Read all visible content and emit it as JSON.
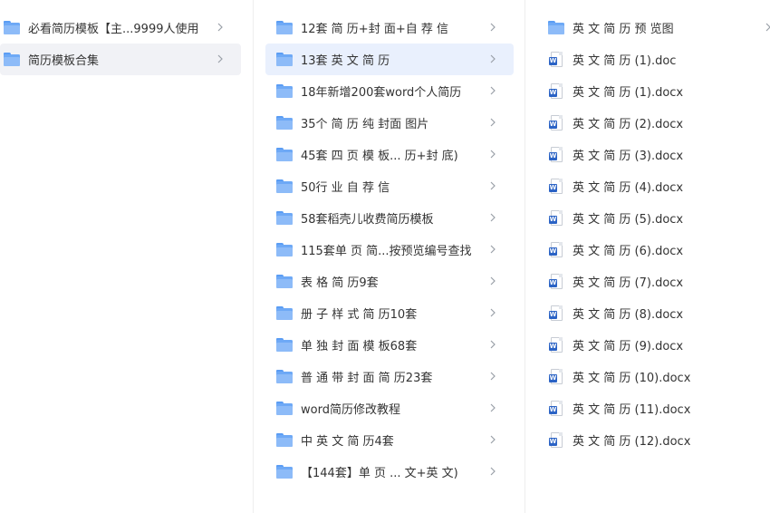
{
  "colors": {
    "folder": "#6ea9f6",
    "selected_bg": "#f1f2f6",
    "active_bg": "#e9f0fd",
    "word_badge": "#2b63c5",
    "text": "#333333",
    "chevron": "#9aa0a8"
  },
  "column1": {
    "items": [
      {
        "label": "必看简历模板【主...9999人使用",
        "icon": "folder-icon"
      },
      {
        "label": "简历模板合集",
        "icon": "folder-icon"
      }
    ]
  },
  "column2": {
    "items": [
      {
        "label": "12套 简 历+封 面+自 荐 信",
        "icon": "folder-icon"
      },
      {
        "label": "13套 英 文 简 历",
        "icon": "folder-icon"
      },
      {
        "label": "18年新增200套word个人简历",
        "icon": "folder-icon"
      },
      {
        "label": "35个 简 历 纯 封面 图片",
        "icon": "folder-icon"
      },
      {
        "label": "45套 四 页 模 板...  历+封 底)",
        "icon": "folder-icon"
      },
      {
        "label": "50行 业 自 荐 信",
        "icon": "folder-icon"
      },
      {
        "label": "58套稻壳儿收费简历模板",
        "icon": "folder-icon"
      },
      {
        "label": "115套单 页 简...按预览编号查找",
        "icon": "folder-icon"
      },
      {
        "label": "表 格 简 历9套",
        "icon": "folder-icon"
      },
      {
        "label": "册 子 样 式 简 历10套",
        "icon": "folder-icon"
      },
      {
        "label": "单 独 封 面 模  板68套",
        "icon": "folder-icon"
      },
      {
        "label": "普 通 带 封 面 简 历23套",
        "icon": "folder-icon"
      },
      {
        "label": "word简历修改教程",
        "icon": "folder-icon"
      },
      {
        "label": "中 英 文 简 历4套",
        "icon": "folder-icon"
      },
      {
        "label": "【144套】单 页 ...  文+英 文)",
        "icon": "folder-icon"
      }
    ]
  },
  "column3": {
    "items": [
      {
        "label": "英 文 简 历 预 览图",
        "icon": "folder-icon",
        "type": "folder"
      },
      {
        "label": "英 文 简 历 (1).doc",
        "icon": "word-doc-icon",
        "type": "file"
      },
      {
        "label": "英 文 简 历 (1).docx",
        "icon": "word-doc-icon",
        "type": "file"
      },
      {
        "label": "英 文 简 历 (2).docx",
        "icon": "word-doc-icon",
        "type": "file"
      },
      {
        "label": "英 文 简 历 (3).docx",
        "icon": "word-doc-icon",
        "type": "file"
      },
      {
        "label": "英 文 简 历 (4).docx",
        "icon": "word-doc-icon",
        "type": "file"
      },
      {
        "label": "英 文 简 历 (5).docx",
        "icon": "word-doc-icon",
        "type": "file"
      },
      {
        "label": "英 文 简 历 (6).docx",
        "icon": "word-doc-icon",
        "type": "file"
      },
      {
        "label": "英 文 简 历 (7).docx",
        "icon": "word-doc-icon",
        "type": "file"
      },
      {
        "label": "英 文 简 历 (8).docx",
        "icon": "word-doc-icon",
        "type": "file"
      },
      {
        "label": "英 文 简 历 (9).docx",
        "icon": "word-doc-icon",
        "type": "file"
      },
      {
        "label": "英 文 简 历 (10).docx",
        "icon": "word-doc-icon",
        "type": "file"
      },
      {
        "label": "英 文 简 历 (11).docx",
        "icon": "word-doc-icon",
        "type": "file"
      },
      {
        "label": "英 文 简 历 (12).docx",
        "icon": "word-doc-icon",
        "type": "file"
      }
    ]
  },
  "word_badge_letter": "W"
}
